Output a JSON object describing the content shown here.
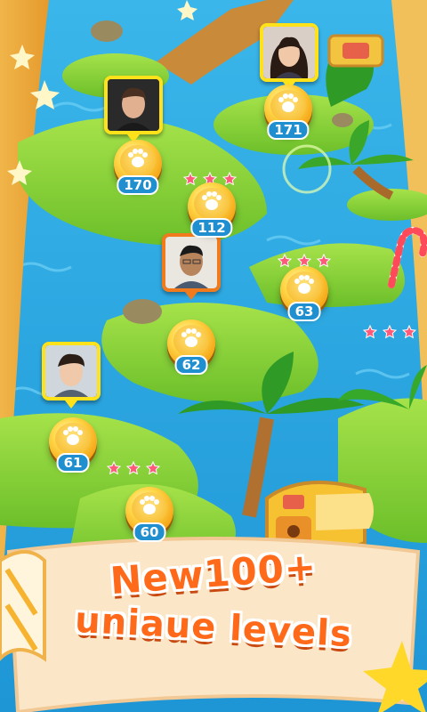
{
  "colors": {
    "water": "#2aa6e0",
    "grass": "#8fd33a",
    "grass_dark": "#5eaa22",
    "banner_text": "#ff6a1a",
    "level_number_bg": "#1f8fd0",
    "avatar_frame": "#ffe21a",
    "avatar_frame_current": "#f07a1c",
    "star": "#ff5a7a"
  },
  "levels": [
    {
      "number": "171",
      "icon": "paw-icon"
    },
    {
      "number": "170",
      "icon": "paw-icon"
    },
    {
      "number": "112",
      "icon": "paw-icon"
    },
    {
      "number": "63",
      "icon": "paw-icon"
    },
    {
      "number": "62",
      "icon": "paw-icon"
    },
    {
      "number": "61",
      "icon": "paw-icon"
    },
    {
      "number": "60",
      "icon": "paw-icon"
    }
  ],
  "star_groups": [
    {
      "stars": 3,
      "icon": "star-icon"
    },
    {
      "stars": 3,
      "icon": "star-icon"
    },
    {
      "stars": 3,
      "icon": "star-icon"
    },
    {
      "stars": 3,
      "icon": "star-icon"
    }
  ],
  "avatars": [
    {
      "name": "friend-avatar-1",
      "frame": "yellow"
    },
    {
      "name": "friend-avatar-2",
      "frame": "yellow"
    },
    {
      "name": "player-avatar-current",
      "frame": "orange"
    },
    {
      "name": "friend-avatar-3",
      "frame": "yellow"
    }
  ],
  "decorations": [
    "treasure-chest-icon",
    "palm-tree-icon",
    "candy-cane-icon",
    "rock-icon",
    "sparkle-star-icon"
  ],
  "banner": {
    "line1": "New100+",
    "line2": "uniaue levels"
  }
}
